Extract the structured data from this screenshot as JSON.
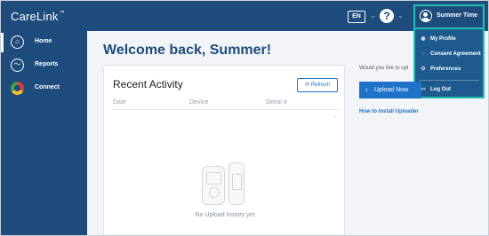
{
  "app": {
    "brand": "CareLink",
    "trademark": "™"
  },
  "header": {
    "language": "EN",
    "help_symbol": "?",
    "user_name": "Summer Time",
    "user_icon": "user-circle-icon"
  },
  "dropdown": {
    "items": [
      {
        "label": "My Profile",
        "icon": "profile-icon",
        "glyph": "◉"
      },
      {
        "label": "Consent Agreement",
        "icon": "consent-icon",
        "glyph": "◌"
      },
      {
        "label": "Preferences",
        "icon": "preferences-icon",
        "glyph": "⚙"
      },
      {
        "label": "Log Out",
        "icon": "logout-icon",
        "glyph": "↤"
      }
    ]
  },
  "sidebar": {
    "items": [
      {
        "label": "Home",
        "icon": "home-icon",
        "glyph": "⌂",
        "active": true
      },
      {
        "label": "Reports",
        "icon": "reports-icon",
        "glyph": "〜",
        "active": false
      },
      {
        "label": "Connect",
        "icon": "connect-icon",
        "active": false
      }
    ]
  },
  "main": {
    "welcome": "Welcome back, Summer!",
    "recent_activity": {
      "title": "Recent Activity",
      "refresh_label": "Refresh",
      "columns": [
        "Date",
        "Device",
        "Serial #"
      ],
      "empty_message": "No Upload history yet"
    },
    "upload": {
      "prompt": "Would you like to upl",
      "button_label": "Upload Now",
      "install_link": "How to Install Uploader"
    }
  },
  "colors": {
    "header_bg": "#1e4c7c",
    "accent_highlight": "#22c0b4",
    "primary_blue": "#1e73c8"
  }
}
